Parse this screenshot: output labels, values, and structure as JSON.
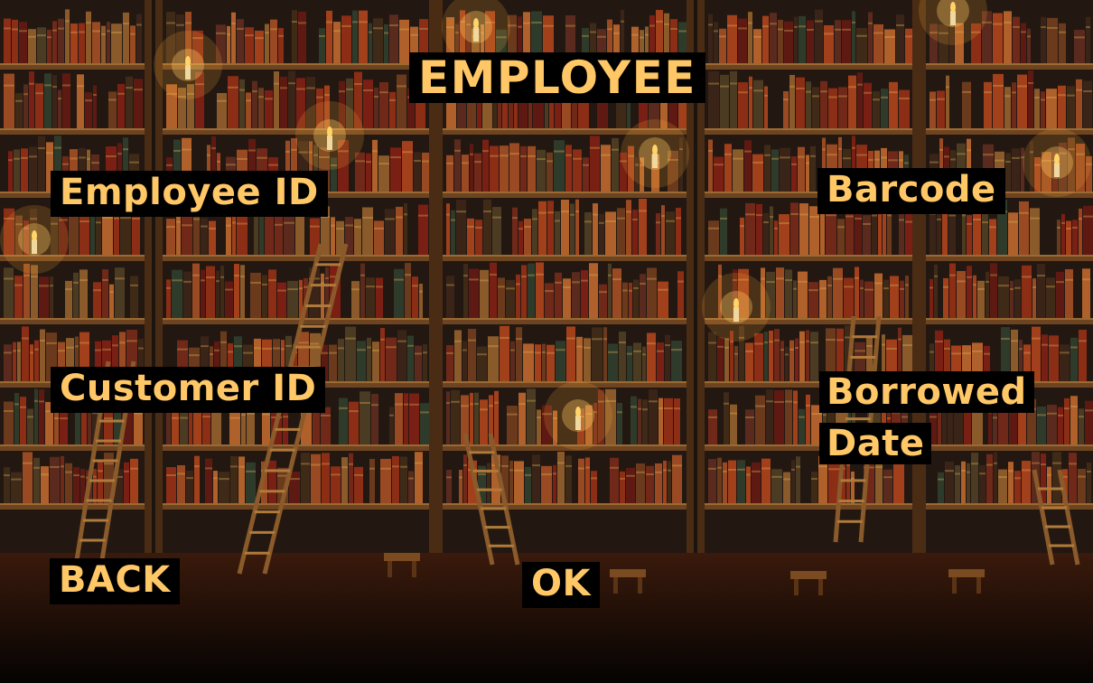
{
  "page": {
    "title": "EMPLOYEE"
  },
  "fields": {
    "employee_id_label": "Employee ID",
    "barcode_label": "Barcode",
    "customer_id_label": "Customer ID",
    "borrowed_date_label_line1": "Borrowed",
    "borrowed_date_label_line2": "Date"
  },
  "buttons": {
    "back_label": "BACK",
    "ok_label": "OK"
  },
  "colors": {
    "label_text": "#ffc766",
    "label_background": "#000000"
  }
}
